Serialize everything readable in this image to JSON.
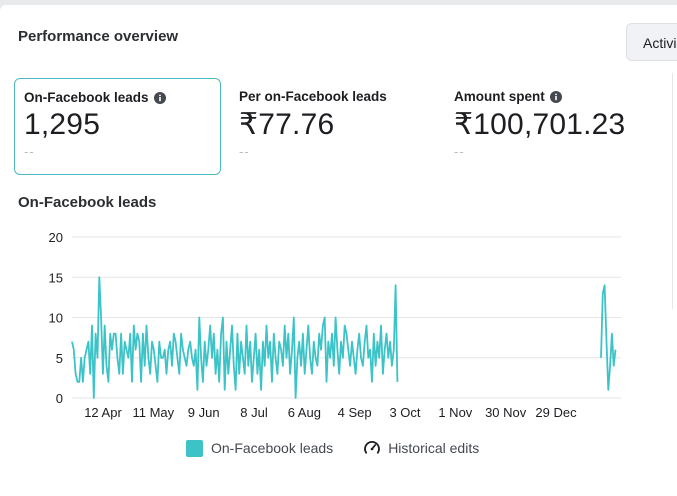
{
  "header": {
    "title": "Performance overview",
    "activity_label": "Activi"
  },
  "metrics": [
    {
      "label": "On-Facebook leads",
      "value": "1,295",
      "compare": "--",
      "has_info": true,
      "active": true
    },
    {
      "label": "Per on-Facebook leads",
      "value": "₹77.76",
      "compare": "--",
      "has_info": false,
      "active": false
    },
    {
      "label": "Amount spent",
      "value": "₹100,701.23",
      "compare": "--",
      "has_info": true,
      "active": false
    }
  ],
  "chart_title": "On-Facebook leads",
  "chart_data": {
    "type": "line",
    "x_tick_labels": [
      "12 Apr",
      "11 May",
      "9 Jun",
      "8 Jul",
      "6 Aug",
      "4 Sep",
      "3 Oct",
      "1 Nov",
      "30 Nov",
      "29 Dec"
    ],
    "y_ticks": [
      0,
      5,
      10,
      15,
      20
    ],
    "ylim": [
      0,
      20
    ],
    "xlim": [
      0,
      302
    ],
    "series": [
      {
        "name": "On-Facebook leads",
        "color": "#3cc3c7",
        "segments": [
          {
            "start_day": 0,
            "values": [
              7,
              6,
              3,
              2,
              2,
              5,
              2,
              5,
              6,
              7,
              3,
              9,
              0,
              8,
              5,
              15,
              10,
              3,
              9,
              4,
              2,
              8,
              6,
              8,
              8,
              5,
              3,
              8,
              3,
              7,
              6,
              5,
              8,
              2,
              9,
              6,
              8,
              7,
              2,
              8,
              4,
              9,
              5,
              3,
              7,
              6,
              4,
              2,
              7,
              5,
              5,
              6,
              3,
              6,
              7,
              4,
              8,
              7,
              5,
              3,
              8,
              6,
              5,
              4,
              6,
              7,
              5,
              4,
              6,
              1,
              10,
              5,
              2,
              7,
              4,
              6,
              9,
              5,
              8,
              3,
              6,
              2,
              8,
              10,
              1,
              7,
              3,
              6,
              9,
              4,
              1,
              8,
              3,
              7,
              5,
              3,
              9,
              4,
              7,
              2,
              5,
              8,
              3,
              6,
              1,
              7,
              4,
              9,
              5,
              7,
              2,
              8,
              5,
              3,
              7,
              6,
              4,
              9,
              5,
              8,
              3,
              6,
              10,
              0,
              5,
              7,
              4,
              8,
              3,
              6,
              9,
              5,
              3,
              7,
              5,
              4,
              8,
              6,
              9,
              10,
              2,
              7,
              5,
              8,
              4,
              10,
              6,
              3,
              7,
              5,
              9,
              8,
              6,
              4,
              7,
              5,
              3,
              6,
              8,
              5,
              4,
              7,
              9,
              5,
              6,
              2,
              8,
              4,
              7,
              5,
              9,
              3,
              6,
              8,
              5,
              7,
              4,
              6,
              14,
              2
            ]
          },
          {
            "start_day": 291,
            "values": [
              5,
              13,
              14,
              7,
              1,
              4,
              8,
              4,
              6
            ]
          }
        ]
      }
    ],
    "legend": [
      {
        "label": "On-Facebook leads"
      },
      {
        "label": "Historical edits"
      }
    ],
    "grid": true
  }
}
